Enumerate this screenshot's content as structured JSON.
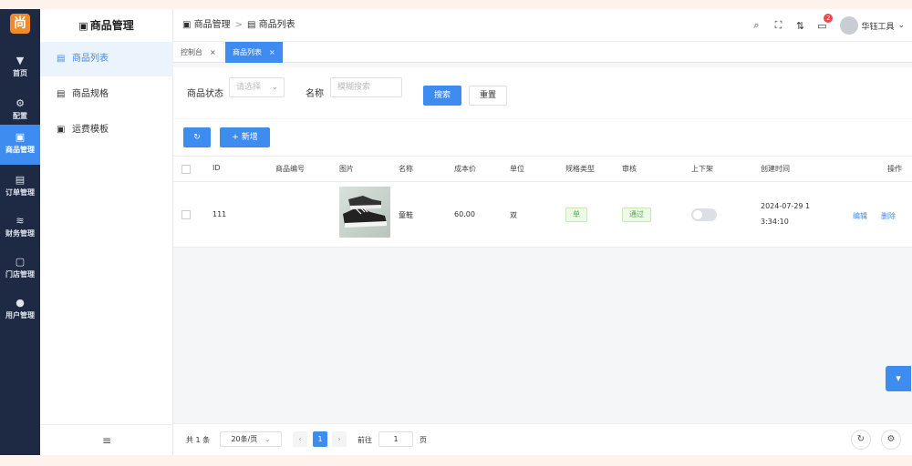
{
  "brand": {
    "logo_text": "尚",
    "accent": "#3f8cf1",
    "rail_color": "#1e2a44"
  },
  "rail": [
    {
      "icon": "home-icon",
      "glyph": "▼",
      "label": "首页"
    },
    {
      "icon": "gear-icon",
      "glyph": "⚙",
      "label": "配置"
    },
    {
      "icon": "shop-icon",
      "glyph": "▣",
      "label": "商品管理"
    },
    {
      "icon": "order-icon",
      "glyph": "▤",
      "label": "订单管理"
    },
    {
      "icon": "finance-icon",
      "glyph": "≋",
      "label": "财务管理"
    },
    {
      "icon": "store-icon",
      "glyph": "▢",
      "label": "门店管理"
    },
    {
      "icon": "user-icon",
      "glyph": "●",
      "label": "用户管理"
    }
  ],
  "menu": {
    "title": "商品管理",
    "items": [
      {
        "icon": "list-icon",
        "glyph": "▤",
        "label": "商品列表"
      },
      {
        "icon": "spec-icon",
        "glyph": "▤",
        "label": "商品规格"
      },
      {
        "icon": "freight-icon",
        "glyph": "▣",
        "label": "运费模板"
      }
    ],
    "collapse_glyph": "≡"
  },
  "header": {
    "crumb_1": "商品管理",
    "crumb_sep": ">",
    "crumb_2": "商品列表",
    "notify_count": "2",
    "user_name": "华钰工具"
  },
  "tabs": [
    {
      "label": "控制台",
      "close": "×"
    },
    {
      "label": "商品列表",
      "close": "×"
    }
  ],
  "filter": {
    "status_label": "商品状态",
    "status_placeholder": "请选择",
    "name_label": "名称",
    "name_placeholder": "模糊搜索",
    "search_label": "搜索",
    "reset_label": "重置"
  },
  "toolbar": {
    "refresh_glyph": "↻",
    "add_label": "+ 新增"
  },
  "table": {
    "columns": [
      "ID",
      "商品编号",
      "图片",
      "名称",
      "成本价",
      "单位",
      "规格类型",
      "审核",
      "上下架",
      "创建时间",
      "操作"
    ],
    "rows": [
      {
        "id": "111",
        "code": "",
        "name": "童鞋",
        "cost": "60.00",
        "unit": "双",
        "spec_type": "单",
        "audit": "通过",
        "on_shelf": false,
        "created_1": "2024-07-29 1",
        "created_2": "3:34:10",
        "edit": "编辑",
        "delete": "删除"
      }
    ]
  },
  "pager": {
    "total": "共 1 条",
    "page_size": "20条/页",
    "prev": "‹",
    "current": "1",
    "next": "›",
    "goto_label": "前往",
    "goto_value": "1",
    "page_unit": "页"
  },
  "float": {
    "glyph": "▾"
  }
}
